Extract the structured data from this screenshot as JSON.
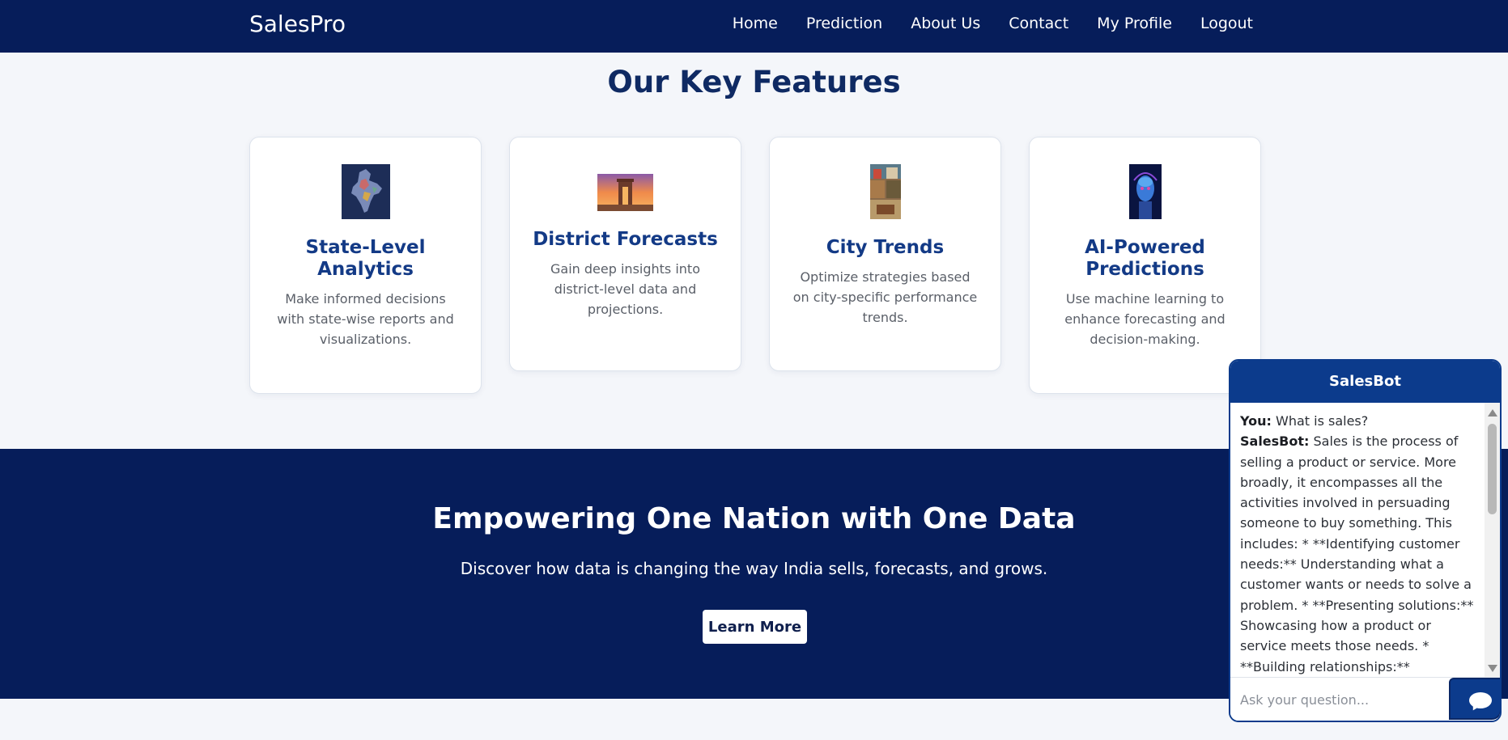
{
  "nav": {
    "brand": "SalesPro",
    "links": [
      "Home",
      "Prediction",
      "About Us",
      "Contact",
      "My Profile",
      "Logout"
    ]
  },
  "features": {
    "title": "Our Key Features",
    "cards": [
      {
        "title": "State-Level Analytics",
        "desc": "Make informed decisions with state-wise reports and visualizations.",
        "icon": "india-map-image"
      },
      {
        "title": "District Forecasts",
        "desc": "Gain deep insights into district-level data and projections.",
        "icon": "india-gate-image"
      },
      {
        "title": "City Trends",
        "desc": "Optimize strategies based on city-specific performance trends.",
        "icon": "city-collage-image"
      },
      {
        "title": "AI-Powered Predictions",
        "desc": "Use machine learning to enhance forecasting and decision-making.",
        "icon": "ai-robot-image"
      }
    ]
  },
  "hero": {
    "title": "Empowering One Nation with One Data",
    "subtitle": "Discover how data is changing the way India sells, forecasts, and grows.",
    "button": "Learn More"
  },
  "chat": {
    "title": "SalesBot",
    "messages": [
      {
        "sender": "You:",
        "text": "What is sales?"
      },
      {
        "sender": "SalesBot:",
        "text": "Sales is the process of selling a product or service. More broadly, it encompasses all the activities involved in persuading someone to buy something. This includes: * **Identifying customer needs:** Understanding what a customer wants or needs to solve a problem. * **Presenting solutions:** Showcasing how a product or service meets those needs. * **Building relationships:** Establishing trust and"
      }
    ],
    "placeholder": "Ask your question...",
    "send_icon": "chat-bubble-icon"
  },
  "colors": {
    "navy": "#061d5a",
    "accent": "#0c3b8c",
    "card_title": "#133a86"
  }
}
